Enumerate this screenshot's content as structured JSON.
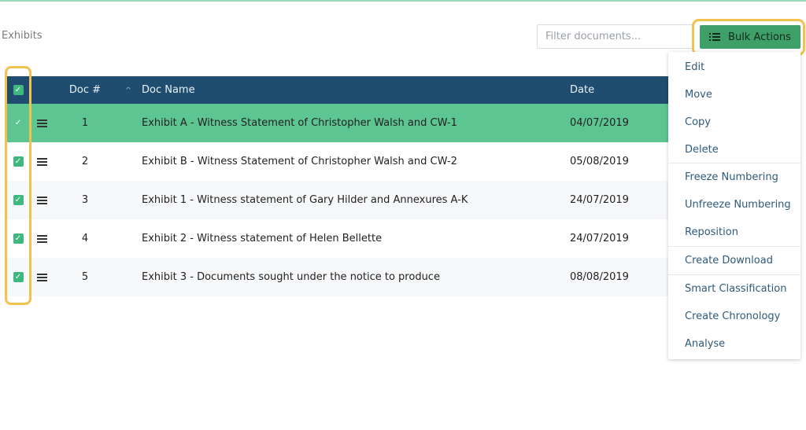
{
  "page": {
    "breadcrumb": "Exhibits"
  },
  "filter": {
    "placeholder": "Filter documents..."
  },
  "bulk_actions": {
    "label": "Bulk Actions"
  },
  "table": {
    "columns": {
      "doc_num": "Doc #",
      "doc_name": "Doc Name",
      "date": "Date"
    },
    "rows": [
      {
        "num": "1",
        "name": "Exhibit A - Witness Statement of Christopher Walsh and CW-1",
        "date": "04/07/2019"
      },
      {
        "num": "2",
        "name": "Exhibit B - Witness Statement of Christopher Walsh and CW-2",
        "date": "05/08/2019"
      },
      {
        "num": "3",
        "name": "Exhibit 1 - Witness statement of Gary Hilder and Annexures A-K",
        "date": "24/07/2019"
      },
      {
        "num": "4",
        "name": "Exhibit 2 - Witness statement of Helen Bellette",
        "date": "24/07/2019"
      },
      {
        "num": "5",
        "name": "Exhibit 3 - Documents sought under the notice to produce",
        "date": "08/08/2019"
      }
    ]
  },
  "menu": {
    "items": [
      "Edit",
      "Move",
      "Copy",
      "Delete",
      "Freeze Numbering",
      "Unfreeze Numbering",
      "Reposition",
      "Create Download",
      "Smart Classification",
      "Create Chronology",
      "Analyse"
    ]
  },
  "colors": {
    "header": "#1f4d70",
    "accent": "#3f9f68",
    "selected_row": "#5dc592",
    "highlight": "#f2c14e",
    "menu_text": "#2f5a7b"
  },
  "icons": {
    "check": "check-icon",
    "drag": "drag-handle-icon",
    "list": "list-icon",
    "sort": "sort-caret-icon"
  }
}
